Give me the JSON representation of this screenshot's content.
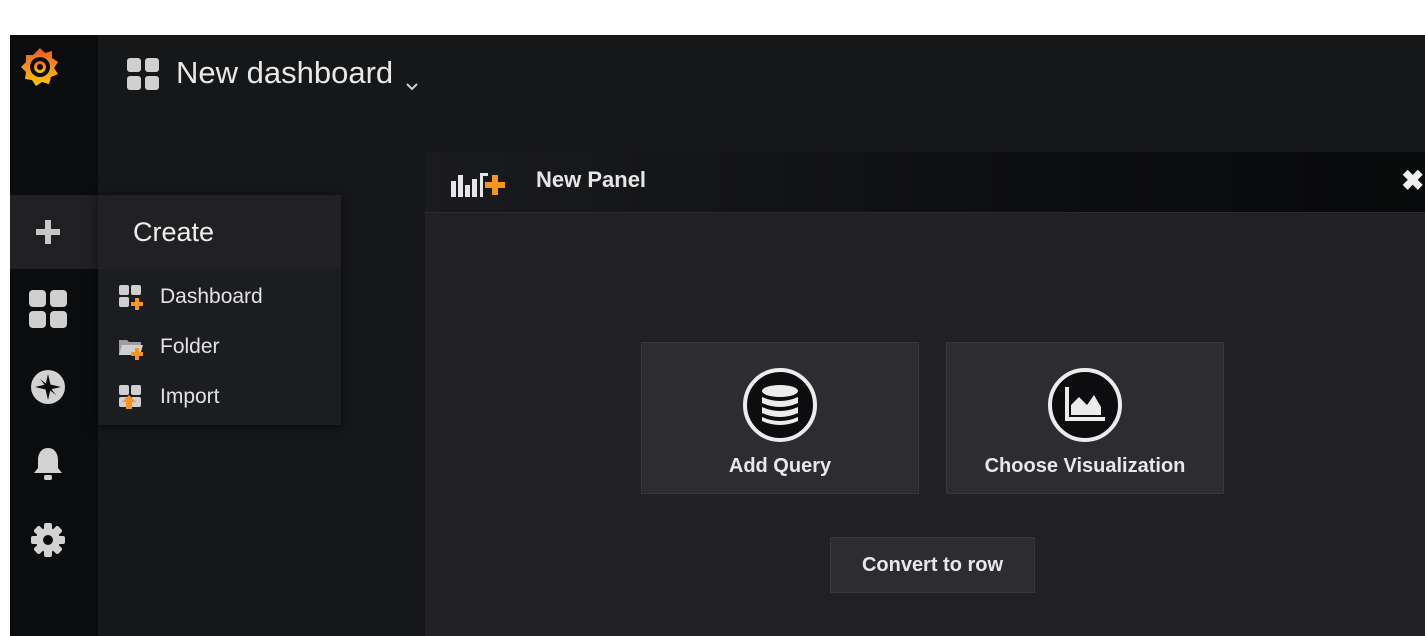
{
  "topbar": {
    "dashboard_title": "New dashboard",
    "caret": "⌄"
  },
  "sidemenu": {
    "items": [
      {
        "icon": "plus-icon"
      },
      {
        "icon": "dashboards-icon"
      },
      {
        "icon": "explore-compass-icon"
      },
      {
        "icon": "bell-icon"
      },
      {
        "icon": "gear-icon"
      }
    ]
  },
  "create_menu": {
    "header": "Create",
    "items": [
      {
        "label": "Dashboard",
        "icon": "dashboard-add-icon"
      },
      {
        "label": "Folder",
        "icon": "folder-add-icon"
      },
      {
        "label": "Import",
        "icon": "import-icon"
      }
    ]
  },
  "panel": {
    "title": "New Panel",
    "close_glyph": "✖",
    "add_query_label": "Add Query",
    "choose_visualization_label": "Choose Visualization",
    "convert_to_row_label": "Convert to row"
  },
  "colors": {
    "accent_orange": "#f7941d",
    "background": "#161719",
    "sidebar": "#0b0c0e"
  }
}
